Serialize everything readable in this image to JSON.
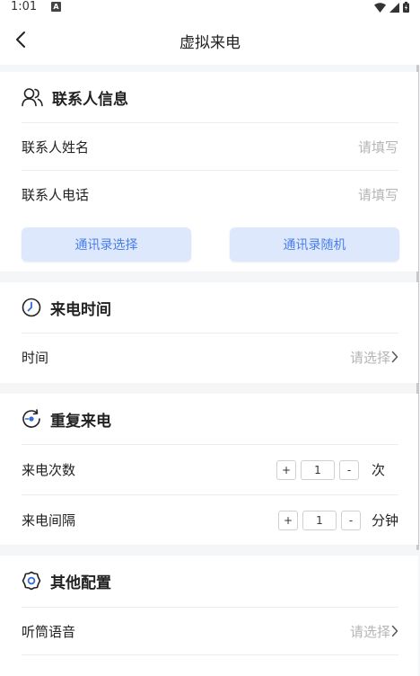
{
  "status": {
    "time": "1:01",
    "notif": "A"
  },
  "nav": {
    "title": "虚拟来电"
  },
  "contact": {
    "title": "联系人信息",
    "name_label": "联系人姓名",
    "name_placeholder": "请填写",
    "phone_label": "联系人电话",
    "phone_placeholder": "请填写",
    "btn_select": "通讯录选择",
    "btn_random": "通讯录随机"
  },
  "call_time": {
    "title": "来电时间",
    "time_label": "时间",
    "time_value": "请选择"
  },
  "repeat": {
    "title": "重复来电",
    "count_label": "来电次数",
    "count_value": "1",
    "count_unit": "次",
    "interval_label": "来电间隔",
    "interval_value": "1",
    "interval_unit": "分钟",
    "plus": "+",
    "minus": "-"
  },
  "other": {
    "title": "其他配置",
    "voice_label": "听筒语音",
    "voice_value": "请选择"
  },
  "colors": {
    "accent": "#4a7fe6",
    "button_bg": "#dde8fd",
    "icon_blue": "#2f6bdb",
    "page_bg": "#f5f6f8"
  }
}
